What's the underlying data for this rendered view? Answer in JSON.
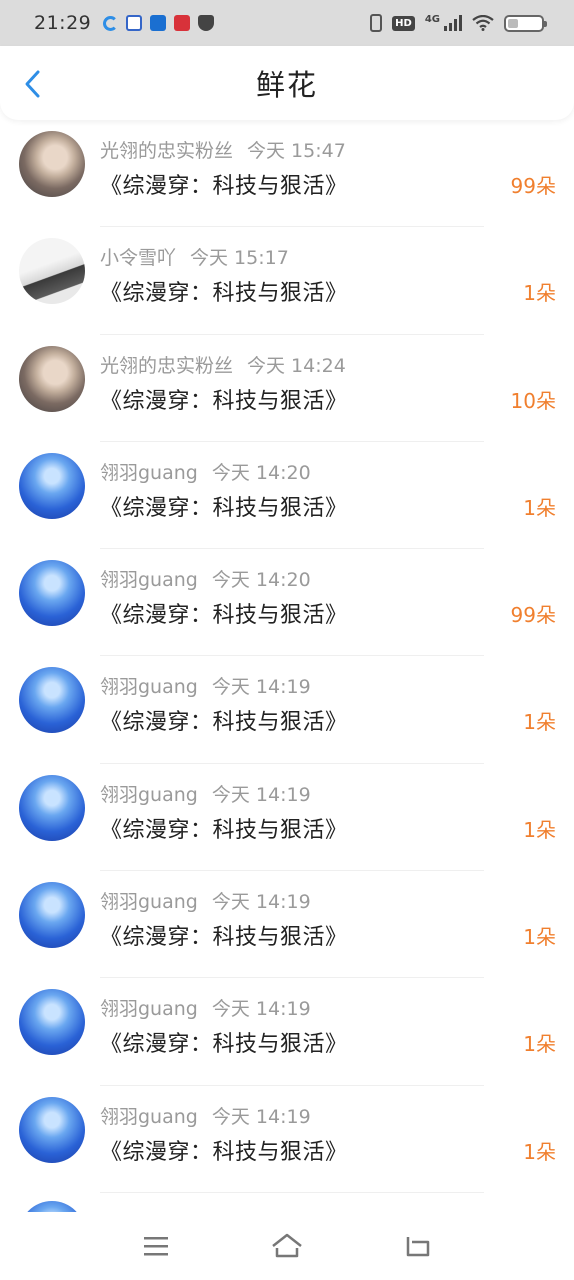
{
  "status_bar": {
    "time": "21:29",
    "network": "4G",
    "hd": "HD",
    "left_icons": [
      "sync-icon",
      "baidu-icon",
      "blue-app-icon",
      "red-app-icon",
      "shield-icon"
    ],
    "right_icons": [
      "vibrate-icon",
      "hd-icon",
      "signal-icon",
      "wifi-icon",
      "battery-icon"
    ]
  },
  "header": {
    "title": "鲜花",
    "back_icon": "chevron-left-icon",
    "accent_color": "#2e8ee6"
  },
  "list": {
    "count_color": "#f07f2e",
    "items": [
      {
        "user": "光翎的忠实粉丝",
        "time": "今天  15:47",
        "book": "《综漫穿：科技与狠活》",
        "count": "99朵",
        "avatar": "gray"
      },
      {
        "user": "小令雪吖",
        "time": "今天  15:17",
        "book": "《综漫穿：科技与狠活》",
        "count": "1朵",
        "avatar": "photo"
      },
      {
        "user": "光翎的忠实粉丝",
        "time": "今天  14:24",
        "book": "《综漫穿：科技与狠活》",
        "count": "10朵",
        "avatar": "gray"
      },
      {
        "user": "翎羽guang",
        "time": "今天  14:20",
        "book": "《综漫穿：科技与狠活》",
        "count": "1朵",
        "avatar": "blue"
      },
      {
        "user": "翎羽guang",
        "time": "今天  14:20",
        "book": "《综漫穿：科技与狠活》",
        "count": "99朵",
        "avatar": "blue"
      },
      {
        "user": "翎羽guang",
        "time": "今天  14:19",
        "book": "《综漫穿：科技与狠活》",
        "count": "1朵",
        "avatar": "blue"
      },
      {
        "user": "翎羽guang",
        "time": "今天  14:19",
        "book": "《综漫穿：科技与狠活》",
        "count": "1朵",
        "avatar": "blue"
      },
      {
        "user": "翎羽guang",
        "time": "今天  14:19",
        "book": "《综漫穿：科技与狠活》",
        "count": "1朵",
        "avatar": "blue"
      },
      {
        "user": "翎羽guang",
        "time": "今天  14:19",
        "book": "《综漫穿：科技与狠活》",
        "count": "1朵",
        "avatar": "blue"
      },
      {
        "user": "翎羽guang",
        "time": "今天  14:19",
        "book": "《综漫穿：科技与狠活》",
        "count": "1朵",
        "avatar": "blue"
      }
    ]
  },
  "bottom_nav": {
    "icons": [
      "menu-icon",
      "home-icon",
      "back-icon"
    ]
  }
}
